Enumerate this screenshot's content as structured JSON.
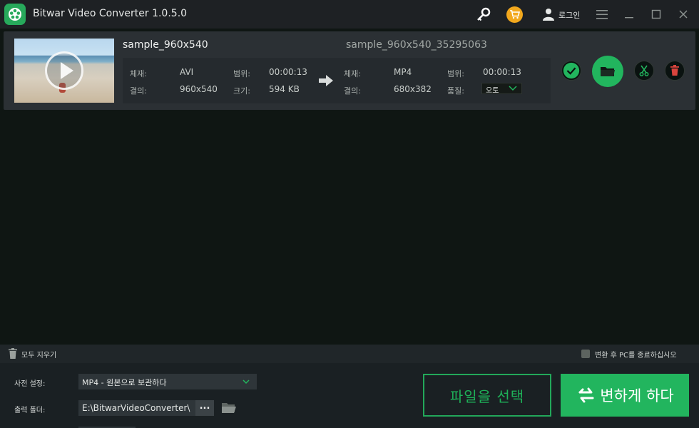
{
  "app": {
    "title": "Bitwar Video Converter  1.0.5.0",
    "login_label": "로그인"
  },
  "file": {
    "source_name": "sample_960x540",
    "target_name": "sample_960x540_35295063",
    "source": {
      "format_label": "체재:",
      "format": "AVI",
      "duration_label": "범위:",
      "duration": "00:00:13",
      "resolution_label": "결의:",
      "resolution": "960x540",
      "size_label": "크기:",
      "size": "594 KB"
    },
    "target": {
      "format_label": "체재:",
      "format": "MP4",
      "duration_label": "범위:",
      "duration": "00:00:13",
      "resolution_label": "결의:",
      "resolution": "680x382",
      "quality_label": "품질:",
      "quality": "오토"
    }
  },
  "bottom": {
    "clear_all": "모두 지우기",
    "shutdown_after": "변환 후 PC를 종료하십시오",
    "preset_label": "사전 설정:",
    "preset_value": "MP4 - 원본으로 보관하다",
    "output_label": "출력 폴더:",
    "output_path": "E:\\BitwarVideoConverter\\",
    "browse": "...",
    "select_files": "파일을 선택",
    "convert": "변하게 하다"
  },
  "colors": {
    "accent": "#22b55e",
    "background": "#0f1613",
    "card": "#2b3034",
    "cart": "#f2a81d",
    "delete": "#d9443d"
  }
}
